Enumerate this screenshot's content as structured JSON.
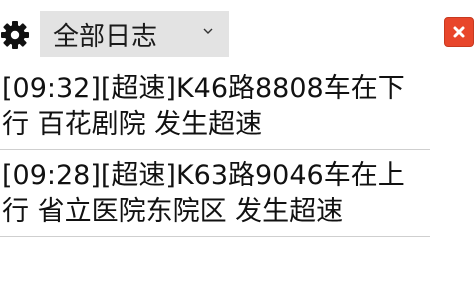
{
  "toolbar": {
    "settings_icon": "gear-icon",
    "filter_value": "全部日志",
    "filter_dropdown_icon": "chevron-down-icon",
    "close_icon": "close-icon",
    "close_color": "#e8462b"
  },
  "log": {
    "items": [
      {
        "text": "[09:32][超速]K46路8808车在下行 百花剧院 发生超速"
      },
      {
        "text": "[09:28][超速]K63路9046车在上行 省立医院东院区 发生超速"
      }
    ]
  }
}
